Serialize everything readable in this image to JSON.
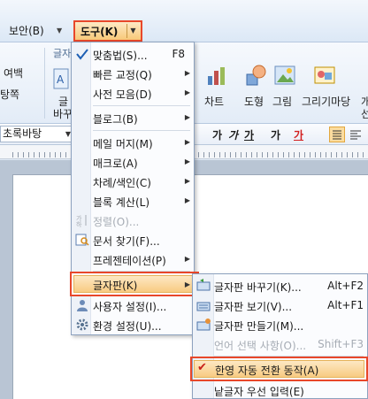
{
  "menubar": {
    "security_label": "보안(B)",
    "tools_label": "도구(K)"
  },
  "ribbon": {
    "group_partial_label": "글자",
    "margin_label": "여백",
    "partial_label_2": "탕쪽",
    "partial_btn_line1": "글",
    "partial_btn_line2": "바꾸",
    "chart_label": "차트",
    "shape_label": "도형",
    "picture_label": "그림",
    "drawing_label": "그리기마당",
    "partial_right_label_1": "개",
    "partial_right_label_2": "선"
  },
  "format_bar": {
    "style_value": "초록바탕",
    "glyph_ga1": "가",
    "glyph_ga2": "가",
    "glyph_ga3": "가",
    "glyph_ga4": "가",
    "glyph_ga5": "가"
  },
  "tools_menu": {
    "items": [
      {
        "label": "맞춤법(S)...",
        "shortcut": "F8",
        "icon": "spellcheck-icon"
      },
      {
        "label": "빠른 교정(Q)",
        "icon": ""
      },
      {
        "label": "사전 모음(D)",
        "icon": ""
      },
      {
        "label": "블로그(B)",
        "icon": ""
      },
      {
        "label": "메일 머지(M)",
        "icon": ""
      },
      {
        "label": "매크로(A)",
        "icon": ""
      },
      {
        "label": "차례/색인(C)",
        "icon": ""
      },
      {
        "label": "블록 계산(L)",
        "icon": ""
      },
      {
        "label": "정렬(O)...",
        "icon": "sort-icon"
      },
      {
        "label": "문서 찾기(F)...",
        "icon": "find-document-icon"
      },
      {
        "label": "프레젠테이션(P)",
        "icon": ""
      },
      {
        "label": "글자판(K)",
        "icon": ""
      },
      {
        "label": "사용자 설정(I)...",
        "icon": "user-settings-icon"
      },
      {
        "label": "환경 설정(U)...",
        "icon": "preferences-icon"
      }
    ]
  },
  "keyboard_submenu": {
    "items": [
      {
        "label": "글자판 바꾸기(K)...",
        "shortcut": "Alt+F2",
        "icon": "keyboard-switch-icon"
      },
      {
        "label": "글자판 보기(V)...",
        "shortcut": "Alt+F1",
        "icon": "keyboard-view-icon"
      },
      {
        "label": "글자판 만들기(M)...",
        "shortcut": "",
        "icon": "keyboard-create-icon"
      },
      {
        "label": "언어 선택 사항(O)...",
        "shortcut": "Shift+F3",
        "icon": ""
      },
      {
        "label": "한영 자동 전환 동작(A)",
        "shortcut": "",
        "icon": "checkmark-icon"
      },
      {
        "label": "낱글자 우선 입력(E)",
        "shortcut": "",
        "icon": ""
      }
    ]
  },
  "colors": {
    "highlight_border": "#e8472a",
    "highlight_fill": "#f8cb82",
    "check_mark": "#c8201b"
  }
}
